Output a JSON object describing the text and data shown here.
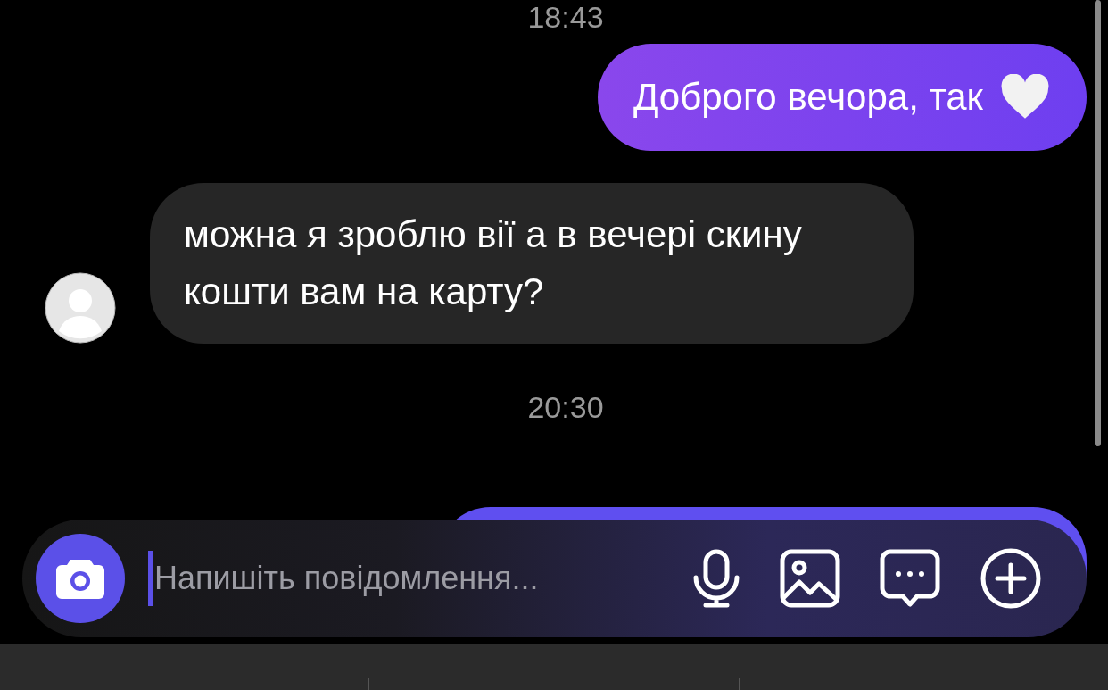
{
  "chat": {
    "messages": [
      {
        "kind": "time",
        "text": "18:43"
      },
      {
        "kind": "sent",
        "text": "Доброго вечора, так"
      },
      {
        "kind": "received",
        "text": "можна я зроблю вії а в вечері скину кошти вам на карту?"
      },
      {
        "kind": "time",
        "text": "20:30"
      }
    ]
  },
  "composer": {
    "placeholder": "Напишіть повідомлення..."
  }
}
